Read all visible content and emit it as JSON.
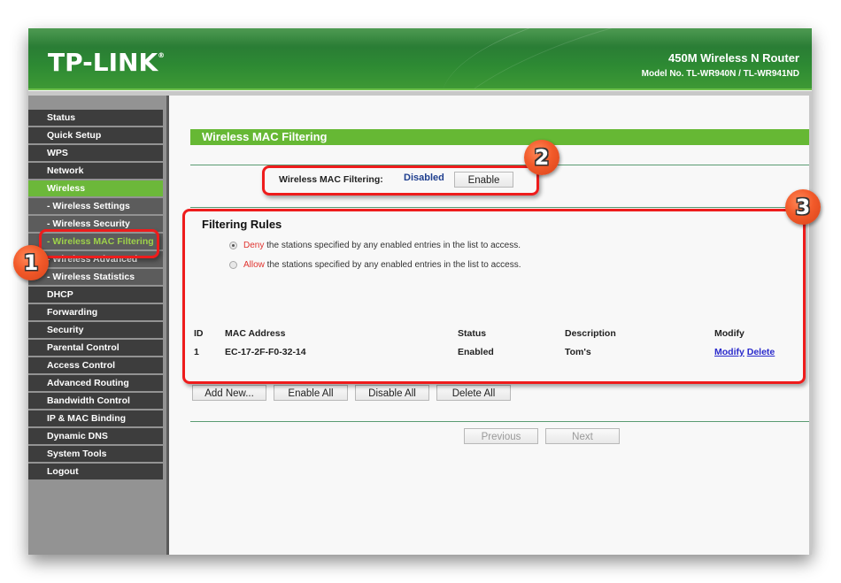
{
  "header": {
    "logo": "TP-LINK",
    "logo_mark": "®",
    "product_name": "450M Wireless N Router",
    "model": "Model No. TL-WR940N / TL-WR941ND"
  },
  "sidebar": {
    "items": [
      {
        "label": "Status",
        "type": "main"
      },
      {
        "label": "Quick Setup",
        "type": "main"
      },
      {
        "label": "WPS",
        "type": "main"
      },
      {
        "label": "Network",
        "type": "main"
      },
      {
        "label": "Wireless",
        "type": "main",
        "active": true
      },
      {
        "label": "- Wireless Settings",
        "type": "sub"
      },
      {
        "label": "- Wireless Security",
        "type": "sub"
      },
      {
        "label": "- Wireless MAC Filtering",
        "type": "sub",
        "current": true
      },
      {
        "label": "- Wireless Advanced",
        "type": "sub"
      },
      {
        "label": "- Wireless Statistics",
        "type": "sub"
      },
      {
        "label": "DHCP",
        "type": "main"
      },
      {
        "label": "Forwarding",
        "type": "main"
      },
      {
        "label": "Security",
        "type": "main"
      },
      {
        "label": "Parental Control",
        "type": "main"
      },
      {
        "label": "Access Control",
        "type": "main"
      },
      {
        "label": "Advanced Routing",
        "type": "main"
      },
      {
        "label": "Bandwidth Control",
        "type": "main"
      },
      {
        "label": "IP & MAC Binding",
        "type": "main"
      },
      {
        "label": "Dynamic DNS",
        "type": "main"
      },
      {
        "label": "System Tools",
        "type": "main"
      },
      {
        "label": "Logout",
        "type": "main"
      }
    ]
  },
  "main": {
    "page_title": "Wireless MAC Filtering",
    "filter_status_label": "Wireless MAC Filtering:",
    "filter_status_value": "Disabled",
    "enable_button": "Enable",
    "rules_title": "Filtering Rules",
    "rules": [
      {
        "keyword": "Deny",
        "text": " the stations specified by any enabled entries in the list to access.",
        "checked": true
      },
      {
        "keyword": "Allow",
        "text": " the stations specified by any enabled entries in the list to access.",
        "checked": false
      }
    ],
    "table": {
      "headers": [
        "ID",
        "MAC Address",
        "Status",
        "Description",
        "Modify"
      ],
      "rows": [
        {
          "id": "1",
          "mac": "EC-17-2F-F0-32-14",
          "status": "Enabled",
          "description": "Tom's",
          "modify_link": "Modify",
          "delete_link": "Delete"
        }
      ]
    },
    "buttons": {
      "add_new": "Add New...",
      "enable_all": "Enable All",
      "disable_all": "Disable All",
      "delete_all": "Delete All",
      "previous": "Previous",
      "next": "Next"
    }
  },
  "annotations": {
    "badge_1": "1",
    "badge_2": "2",
    "badge_3": "3",
    "highlight_color": "#ee1c1c",
    "badge_color": "#f25a2a"
  },
  "colors": {
    "brand_green": "#2d8a33",
    "accent_green": "#66b834",
    "menu_dark": "#3d3d3d",
    "link_blue": "#2a2acc",
    "status_blue": "#1f3f8f"
  }
}
